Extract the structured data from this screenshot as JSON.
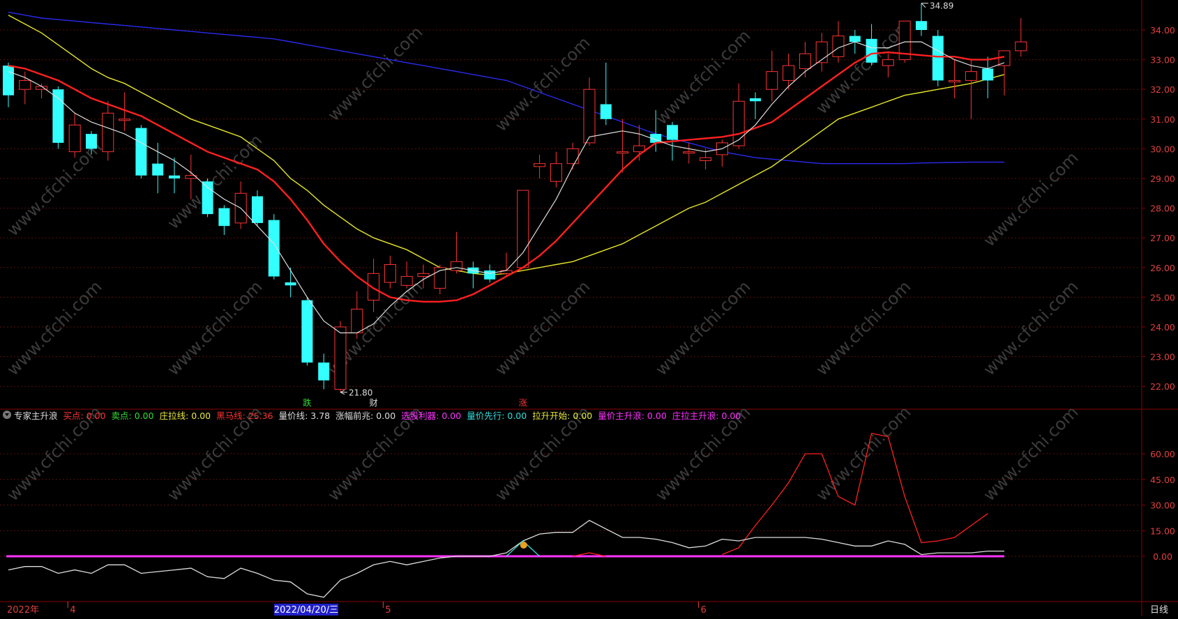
{
  "watermark": "www.cfchi.com",
  "indicator": {
    "name": "专家主升浪",
    "items": [
      {
        "label": "买点",
        "value": "0.00",
        "color": "#ff3333"
      },
      {
        "label": "卖点",
        "value": "0.00",
        "color": "#33dd33"
      },
      {
        "label": "庄拉线",
        "value": "0.00",
        "color": "#e8e83a"
      },
      {
        "label": "黑马线",
        "value": "25.36",
        "color": "#ff3333"
      },
      {
        "label": "量价线",
        "value": "3.78",
        "color": "#dddddd"
      },
      {
        "label": "涨幅前兆",
        "value": "0.00",
        "color": "#dddddd"
      },
      {
        "label": "选股利器",
        "value": "0.00",
        "color": "#ff33ff"
      },
      {
        "label": "量价先行",
        "value": "0.00",
        "color": "#33dddd"
      },
      {
        "label": "拉升开始",
        "value": "0.00",
        "color": "#e8e83a"
      },
      {
        "label": "量价主升浪",
        "value": "0.00",
        "color": "#ff33ff"
      },
      {
        "label": "庄拉主升浪",
        "value": "0.00",
        "color": "#ff33ff"
      }
    ]
  },
  "bottom_axis": {
    "year": "2022年",
    "month_labels": [
      "4",
      "5",
      "6"
    ],
    "cursor_date": "2022/04/20/三",
    "period": "日线"
  },
  "chart_data": [
    {
      "type": "candlestick",
      "ylim": [
        21.5,
        35.0
      ],
      "yticks": [
        "22.00",
        "23.00",
        "24.00",
        "25.00",
        "26.00",
        "27.00",
        "28.00",
        "29.00",
        "30.00",
        "31.00",
        "32.00",
        "33.00",
        "34.00"
      ],
      "high_label": "34.89",
      "low_label": "21.80",
      "signals": [
        {
          "text": "跌",
          "index": 18,
          "color": "#33dd33"
        },
        {
          "text": "财",
          "index": 22,
          "color": "#dddddd"
        },
        {
          "text": "涨",
          "index": 31,
          "color": "#ff3333"
        }
      ],
      "colors": {
        "up": "#ff3333",
        "down": "#33ffff",
        "ma5": "#dddddd",
        "ma10": "#ff2020",
        "ma20": "#e6e629",
        "ma60": "#2a2af0"
      },
      "candles": [
        {
          "o": 32.8,
          "h": 32.9,
          "c": 31.8,
          "l": 31.4
        },
        {
          "o": 32.0,
          "h": 32.6,
          "c": 32.3,
          "l": 31.5
        },
        {
          "o": 32.0,
          "h": 32.2,
          "c": 32.1,
          "l": 31.7
        },
        {
          "o": 32.0,
          "h": 32.1,
          "c": 30.2,
          "l": 30.0
        },
        {
          "o": 29.9,
          "h": 31.2,
          "c": 30.8,
          "l": 29.7
        },
        {
          "o": 30.5,
          "h": 30.6,
          "c": 30.0,
          "l": 29.8
        },
        {
          "o": 29.9,
          "h": 31.6,
          "c": 31.2,
          "l": 29.6
        },
        {
          "o": 31.0,
          "h": 31.9,
          "c": 31.0,
          "l": 30.6
        },
        {
          "o": 30.7,
          "h": 30.8,
          "c": 29.1,
          "l": 29.0
        },
        {
          "o": 29.5,
          "h": 30.2,
          "c": 29.1,
          "l": 28.5
        },
        {
          "o": 29.1,
          "h": 29.7,
          "c": 29.0,
          "l": 28.5
        },
        {
          "o": 29.0,
          "h": 29.8,
          "c": 29.1,
          "l": 28.3
        },
        {
          "o": 28.9,
          "h": 29.0,
          "c": 27.8,
          "l": 27.7
        },
        {
          "o": 28.0,
          "h": 28.1,
          "c": 27.4,
          "l": 27.1
        },
        {
          "o": 27.5,
          "h": 28.9,
          "c": 28.5,
          "l": 27.3
        },
        {
          "o": 28.4,
          "h": 28.6,
          "c": 27.5,
          "l": 27.4
        },
        {
          "o": 27.6,
          "h": 27.8,
          "c": 25.7,
          "l": 25.6
        },
        {
          "o": 25.5,
          "h": 26.0,
          "c": 25.4,
          "l": 25.0
        },
        {
          "o": 24.9,
          "h": 25.0,
          "c": 22.8,
          "l": 22.7
        },
        {
          "o": 22.8,
          "h": 23.1,
          "c": 22.2,
          "l": 21.9
        },
        {
          "o": 21.9,
          "h": 24.2,
          "c": 24.0,
          "l": 21.8
        },
        {
          "o": 23.8,
          "h": 25.2,
          "c": 24.6,
          "l": 23.6
        },
        {
          "o": 24.9,
          "h": 26.3,
          "c": 25.8,
          "l": 24.5
        },
        {
          "o": 25.5,
          "h": 26.4,
          "c": 26.1,
          "l": 25.3
        },
        {
          "o": 25.4,
          "h": 26.2,
          "c": 25.7,
          "l": 25.3
        },
        {
          "o": 25.7,
          "h": 26.1,
          "c": 25.8,
          "l": 25.3
        },
        {
          "o": 25.3,
          "h": 26.1,
          "c": 26.0,
          "l": 25.1
        },
        {
          "o": 25.9,
          "h": 27.2,
          "c": 26.2,
          "l": 25.8
        },
        {
          "o": 26.0,
          "h": 26.2,
          "c": 25.8,
          "l": 25.3
        },
        {
          "o": 25.9,
          "h": 26.1,
          "c": 25.6,
          "l": 25.5
        },
        {
          "o": 25.8,
          "h": 26.5,
          "c": 25.9,
          "l": 25.7
        },
        {
          "o": 26.0,
          "h": 28.6,
          "c": 28.6,
          "l": 26.0
        },
        {
          "o": 29.4,
          "h": 29.8,
          "c": 29.5,
          "l": 29.0
        },
        {
          "o": 28.9,
          "h": 29.9,
          "c": 29.5,
          "l": 28.7
        },
        {
          "o": 29.5,
          "h": 30.2,
          "c": 30.0,
          "l": 29.3
        },
        {
          "o": 30.2,
          "h": 32.4,
          "c": 32.0,
          "l": 30.1
        },
        {
          "o": 31.5,
          "h": 32.9,
          "c": 31.0,
          "l": 30.8
        },
        {
          "o": 29.9,
          "h": 31.0,
          "c": 29.9,
          "l": 29.2
        },
        {
          "o": 29.9,
          "h": 30.8,
          "c": 30.1,
          "l": 29.6
        },
        {
          "o": 30.5,
          "h": 31.3,
          "c": 30.2,
          "l": 29.9
        },
        {
          "o": 30.8,
          "h": 30.9,
          "c": 30.3,
          "l": 29.6
        },
        {
          "o": 29.9,
          "h": 30.2,
          "c": 29.9,
          "l": 29.5
        },
        {
          "o": 29.6,
          "h": 30.0,
          "c": 29.7,
          "l": 29.3
        },
        {
          "o": 29.8,
          "h": 30.3,
          "c": 30.2,
          "l": 29.4
        },
        {
          "o": 30.1,
          "h": 32.2,
          "c": 31.6,
          "l": 30.0
        },
        {
          "o": 31.7,
          "h": 31.9,
          "c": 31.6,
          "l": 31.0
        },
        {
          "o": 32.0,
          "h": 33.3,
          "c": 32.6,
          "l": 31.6
        },
        {
          "o": 32.3,
          "h": 33.2,
          "c": 32.8,
          "l": 32.0
        },
        {
          "o": 32.7,
          "h": 33.6,
          "c": 33.2,
          "l": 32.4
        },
        {
          "o": 32.9,
          "h": 33.9,
          "c": 33.6,
          "l": 32.6
        },
        {
          "o": 33.1,
          "h": 34.3,
          "c": 33.8,
          "l": 32.9
        },
        {
          "o": 33.8,
          "h": 34.0,
          "c": 33.6,
          "l": 33.2
        },
        {
          "o": 33.7,
          "h": 34.2,
          "c": 32.9,
          "l": 32.8
        },
        {
          "o": 32.8,
          "h": 33.2,
          "c": 33.0,
          "l": 32.4
        },
        {
          "o": 33.0,
          "h": 34.3,
          "c": 34.3,
          "l": 32.9
        },
        {
          "o": 34.3,
          "h": 34.9,
          "c": 34.0,
          "l": 33.8
        },
        {
          "o": 33.8,
          "h": 34.0,
          "c": 32.3,
          "l": 32.1
        },
        {
          "o": 32.3,
          "h": 33.0,
          "c": 32.3,
          "l": 31.7
        },
        {
          "o": 32.3,
          "h": 33.0,
          "c": 32.6,
          "l": 31.0
        },
        {
          "o": 32.7,
          "h": 33.1,
          "c": 32.3,
          "l": 31.7
        },
        {
          "o": 32.8,
          "h": 33.2,
          "c": 33.3,
          "l": 31.8
        },
        {
          "o": 33.3,
          "h": 34.4,
          "c": 33.6,
          "l": 33.1
        }
      ],
      "ma60": [
        34.6,
        34.5,
        34.4,
        34.35,
        34.3,
        34.25,
        34.2,
        34.15,
        34.1,
        34.05,
        34.0,
        33.95,
        33.9,
        33.85,
        33.8,
        33.75,
        33.7,
        33.6,
        33.5,
        33.4,
        33.3,
        33.2,
        33.1,
        33.0,
        32.9,
        32.8,
        32.7,
        32.6,
        32.5,
        32.4,
        32.3,
        32.1,
        31.9,
        31.7,
        31.5,
        31.3,
        31.1,
        30.9,
        30.7,
        30.5,
        30.35,
        30.2,
        30.05,
        29.9,
        29.8,
        29.7,
        29.65,
        29.6,
        29.55,
        29.5,
        29.5,
        29.5,
        29.5,
        29.5,
        29.5,
        29.52,
        29.53,
        29.54,
        29.55,
        29.55,
        29.55
      ],
      "ma20": [
        34.5,
        34.2,
        33.9,
        33.5,
        33.1,
        32.7,
        32.4,
        32.2,
        31.9,
        31.6,
        31.3,
        31.0,
        30.8,
        30.6,
        30.4,
        30.0,
        29.6,
        29.0,
        28.6,
        28.1,
        27.7,
        27.3,
        27.0,
        26.8,
        26.6,
        26.3,
        26.0,
        25.9,
        25.8,
        25.75,
        25.8,
        25.9,
        26.0,
        26.1,
        26.2,
        26.4,
        26.6,
        26.8,
        27.1,
        27.4,
        27.7,
        28.0,
        28.2,
        28.5,
        28.8,
        29.1,
        29.4,
        29.8,
        30.2,
        30.6,
        31.0,
        31.2,
        31.4,
        31.6,
        31.8,
        31.9,
        32.0,
        32.1,
        32.2,
        32.35,
        32.5
      ],
      "ma10": [
        32.8,
        32.7,
        32.5,
        32.3,
        32.0,
        31.7,
        31.5,
        31.3,
        31.1,
        30.8,
        30.5,
        30.2,
        29.9,
        29.7,
        29.5,
        29.3,
        28.9,
        28.3,
        27.6,
        26.8,
        26.2,
        25.7,
        25.3,
        25.0,
        24.9,
        24.85,
        24.85,
        24.9,
        25.1,
        25.4,
        25.7,
        26.0,
        26.4,
        26.9,
        27.5,
        28.1,
        28.7,
        29.3,
        29.8,
        30.2,
        30.25,
        30.3,
        30.35,
        30.4,
        30.5,
        30.7,
        30.9,
        31.3,
        31.7,
        32.1,
        32.5,
        32.9,
        33.2,
        33.25,
        33.2,
        33.15,
        33.1,
        33.1,
        33.0,
        33.0,
        33.1
      ],
      "ma5": [
        32.6,
        32.4,
        32.1,
        31.7,
        31.2,
        30.9,
        30.7,
        30.5,
        30.2,
        29.9,
        29.6,
        29.2,
        28.7,
        28.3,
        28.0,
        27.4,
        26.8,
        25.9,
        25.0,
        24.2,
        23.8,
        23.8,
        24.1,
        24.7,
        25.2,
        25.6,
        25.9,
        26.0,
        25.9,
        25.8,
        25.9,
        26.5,
        27.4,
        28.3,
        29.4,
        30.4,
        30.5,
        30.6,
        30.5,
        30.3,
        30.1,
        30.0,
        29.9,
        30.0,
        30.3,
        30.8,
        31.5,
        32.1,
        32.6,
        33.0,
        33.4,
        33.6,
        33.4,
        33.4,
        33.6,
        33.6,
        33.3,
        33.0,
        32.8,
        32.7,
        32.9
      ]
    },
    {
      "type": "line",
      "ylim": [
        -18,
        78
      ],
      "yticks": [
        "0.00",
        "15.00",
        "30.00",
        "45.00",
        "60.00"
      ],
      "colors": {
        "heima": "#ff2020",
        "liangjia": "#dddddd",
        "base": "#ff33ff",
        "xianxing": "#33dddd"
      },
      "liangjia": [
        -8,
        -6,
        -6,
        -10,
        -8,
        -10,
        -5,
        -5,
        -10,
        -9,
        -8,
        -7,
        -12,
        -13,
        -7,
        -10,
        -14,
        -15,
        -22,
        -24,
        -14,
        -10,
        -5,
        -3,
        -5,
        -3,
        -1,
        0,
        0,
        0,
        2,
        9,
        13,
        14,
        14,
        21,
        16,
        11,
        11,
        10,
        8,
        5,
        6,
        10,
        9,
        11,
        11,
        11,
        11,
        10,
        8,
        6,
        6,
        9,
        7,
        1,
        2,
        2,
        2,
        3,
        3
      ],
      "heima": [
        null,
        null,
        null,
        null,
        null,
        null,
        null,
        null,
        null,
        null,
        null,
        null,
        null,
        null,
        null,
        null,
        null,
        null,
        null,
        null,
        null,
        null,
        null,
        null,
        null,
        null,
        null,
        null,
        null,
        null,
        null,
        null,
        null,
        null,
        0,
        2,
        0,
        null,
        null,
        null,
        null,
        null,
        null,
        1,
        5,
        18,
        30,
        43,
        60,
        60,
        35,
        30,
        72,
        70,
        35,
        8,
        9,
        11,
        18,
        25
      ],
      "xianxing": [
        {
          "i": 30,
          "v": 0
        },
        {
          "i": 31,
          "v": 9
        },
        {
          "i": 32,
          "v": 0
        }
      ]
    }
  ]
}
